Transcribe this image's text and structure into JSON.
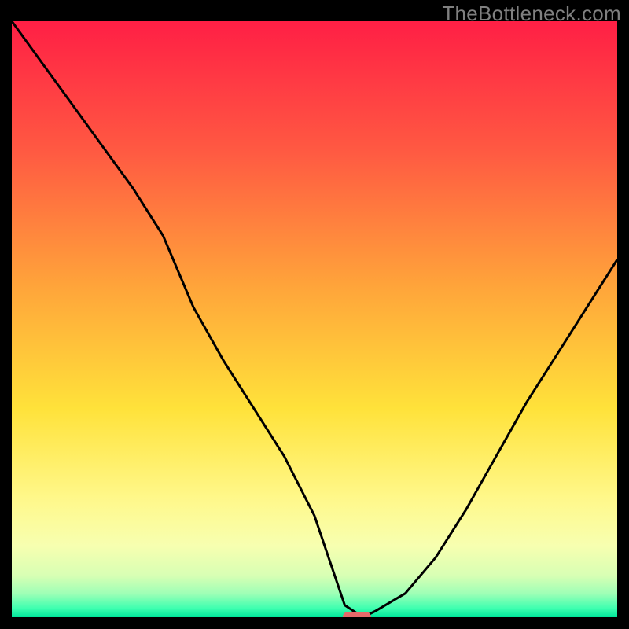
{
  "watermark": "TheBottleneck.com",
  "chart_data": {
    "type": "line",
    "title": "",
    "xlabel": "",
    "ylabel": "",
    "xlim": [
      0,
      100
    ],
    "ylim": [
      0,
      100
    ],
    "x": [
      0,
      5,
      10,
      15,
      20,
      25,
      30,
      35,
      40,
      45,
      50,
      53,
      55,
      58,
      60,
      65,
      70,
      75,
      80,
      85,
      90,
      95,
      100
    ],
    "values": [
      100,
      93,
      86,
      79,
      72,
      64,
      52,
      43,
      35,
      27,
      17,
      8,
      2,
      0,
      1,
      4,
      10,
      18,
      27,
      36,
      44,
      52,
      60
    ],
    "marker": {
      "x": 57,
      "y": 0,
      "color": "#e66a6a"
    },
    "gradient_stops": [
      {
        "offset": 0.0,
        "color": "#ff1f45"
      },
      {
        "offset": 0.22,
        "color": "#ff5a42"
      },
      {
        "offset": 0.45,
        "color": "#ffa63a"
      },
      {
        "offset": 0.65,
        "color": "#ffe23a"
      },
      {
        "offset": 0.8,
        "color": "#fff88a"
      },
      {
        "offset": 0.88,
        "color": "#f7ffb0"
      },
      {
        "offset": 0.93,
        "color": "#d8ffb4"
      },
      {
        "offset": 0.96,
        "color": "#9fffb6"
      },
      {
        "offset": 0.985,
        "color": "#3effb0"
      },
      {
        "offset": 1.0,
        "color": "#00e59a"
      }
    ]
  }
}
